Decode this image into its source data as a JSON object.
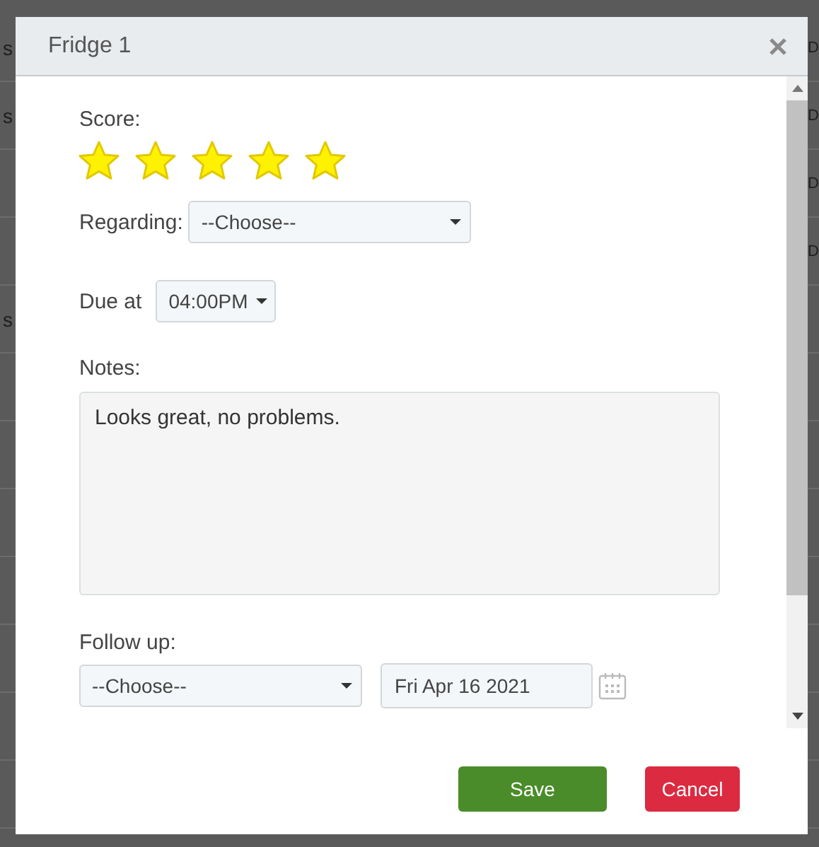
{
  "background_rows": [
    {
      "left": "s",
      "right": "D"
    },
    {
      "left": "s",
      "right": "D"
    },
    {
      "right": "D"
    },
    {
      "right": "D"
    },
    {
      "left": "s"
    }
  ],
  "dialog": {
    "title": "Fridge 1",
    "score": {
      "label": "Score:",
      "stars": 5
    },
    "regarding": {
      "label": "Regarding:",
      "value": "--Choose--"
    },
    "due": {
      "label": "Due at",
      "value": "04:00PM"
    },
    "notes": {
      "label": "Notes:",
      "value": "Looks great, no problems."
    },
    "follow_up": {
      "label": "Follow up:",
      "value": "--Choose--",
      "date": "Fri Apr 16 2021"
    },
    "buttons": [
      {
        "kind": "primary",
        "label": "Save"
      },
      {
        "kind": "danger",
        "label": "Cancel"
      }
    ]
  }
}
